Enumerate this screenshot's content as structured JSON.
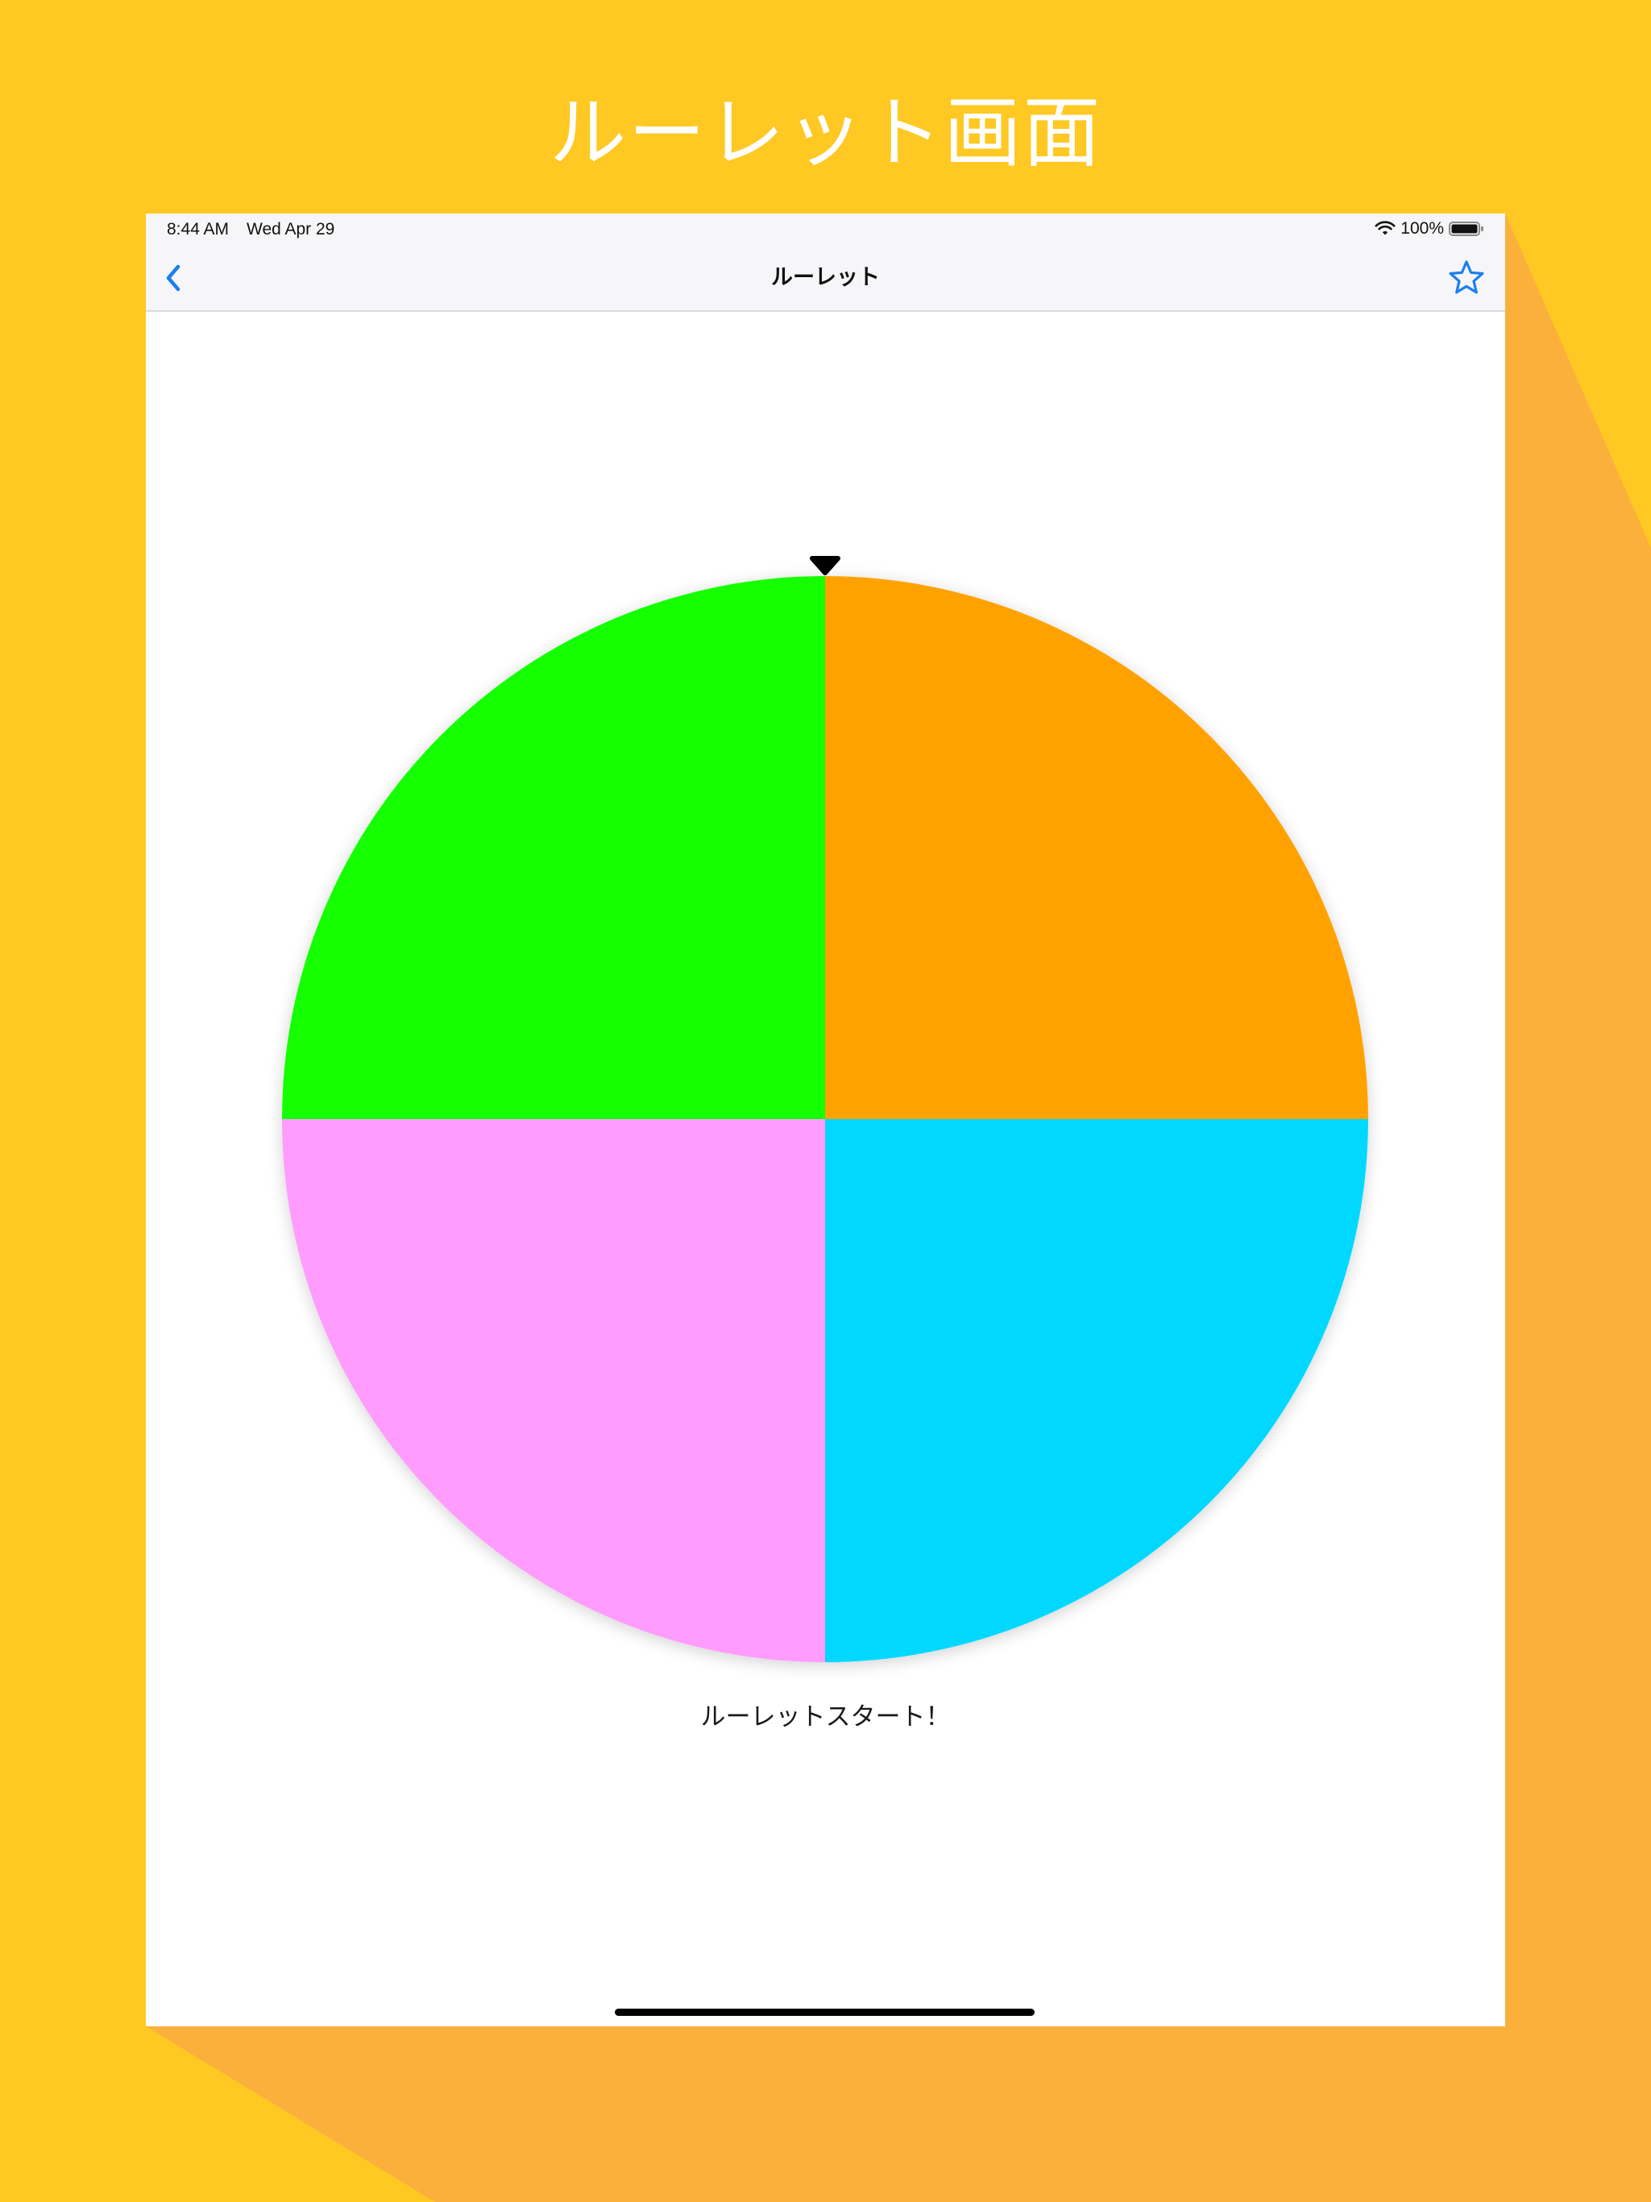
{
  "colors": {
    "background_yellow": "#ffc823",
    "background_shadow": "#fbb03b",
    "accent_blue": "#1a7ff0"
  },
  "headline": "ルーレット画面",
  "status_bar": {
    "time": "8:44 AM",
    "date": "Wed Apr 29",
    "battery_percent": "100%",
    "icons": [
      "wifi-icon",
      "battery-icon"
    ]
  },
  "nav_bar": {
    "title": "ルーレット",
    "left_icon": "chevron-left-icon",
    "right_icon": "star-icon"
  },
  "roulette": {
    "pointer_icon": "triangle-pointer-icon",
    "segments": [
      {
        "color": "#ffa200",
        "share": 0.25
      },
      {
        "color": "#00d8ff",
        "share": 0.25
      },
      {
        "color": "#ff9cfd",
        "share": 0.25
      },
      {
        "color": "#19ff00",
        "share": 0.25
      }
    ]
  },
  "start_button_label": "ルーレットスタート！"
}
